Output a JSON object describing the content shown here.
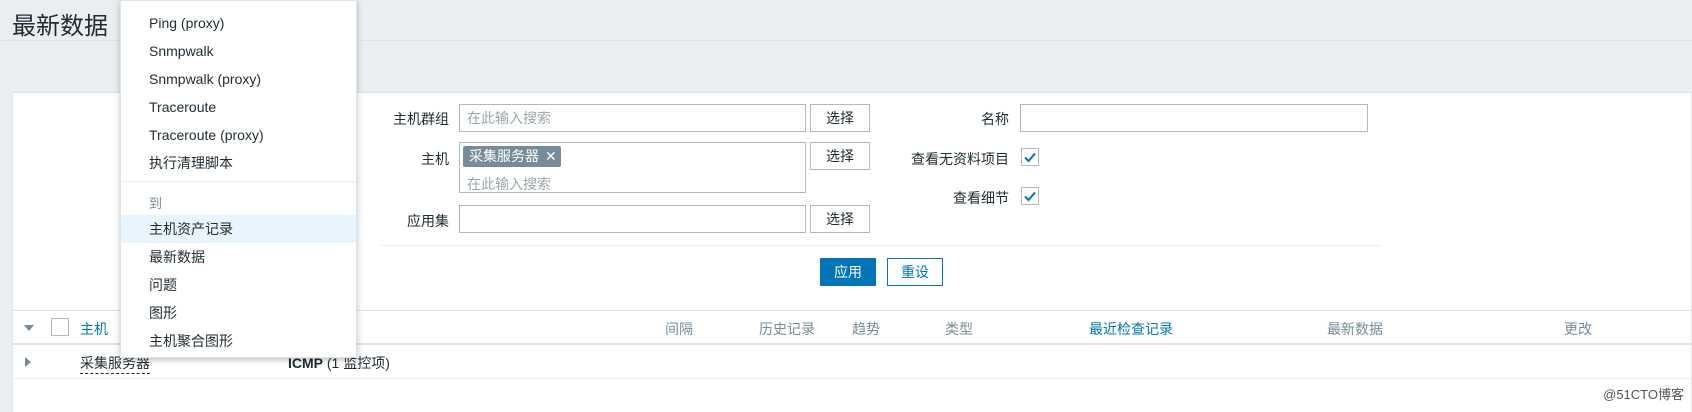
{
  "page": {
    "title": "最新数据"
  },
  "filter": {
    "host_group": {
      "label": "主机群组",
      "placeholder": "在此输入搜索",
      "select": "选择"
    },
    "host": {
      "label": "主机",
      "chip": "采集服务器",
      "placeholder": "在此输入搜索",
      "select": "选择"
    },
    "application": {
      "label": "应用集",
      "value": "",
      "select": "选择"
    },
    "name": {
      "label": "名称",
      "value": ""
    },
    "show_no_data": {
      "label": "查看无资料项目",
      "checked": true
    },
    "show_details": {
      "label": "查看细节",
      "checked": true
    },
    "apply": "应用",
    "reset": "重设"
  },
  "table": {
    "columns": {
      "host": "主机",
      "interval": "间隔",
      "history": "历史记录",
      "trends": "趋势",
      "type": "类型",
      "last_check": "最近检查记录",
      "last_value": "最新数据",
      "change": "更改"
    },
    "rows": [
      {
        "host": "采集服务器",
        "application": "ICMP",
        "count": "(1 监控项)"
      }
    ]
  },
  "context_menu": {
    "scripts": [
      "Ping (proxy)",
      "Snmpwalk",
      "Snmpwalk (proxy)",
      "Traceroute",
      "Traceroute (proxy)",
      "执行清理脚本"
    ],
    "goto_header": "到",
    "goto": [
      "主机资产记录",
      "最新数据",
      "问题",
      "图形",
      "主机聚合图形"
    ]
  },
  "watermark": "@51CTO博客",
  "colors": {
    "primary": "#0275b8",
    "chip": "#768d99",
    "background": "#ebeef0"
  }
}
